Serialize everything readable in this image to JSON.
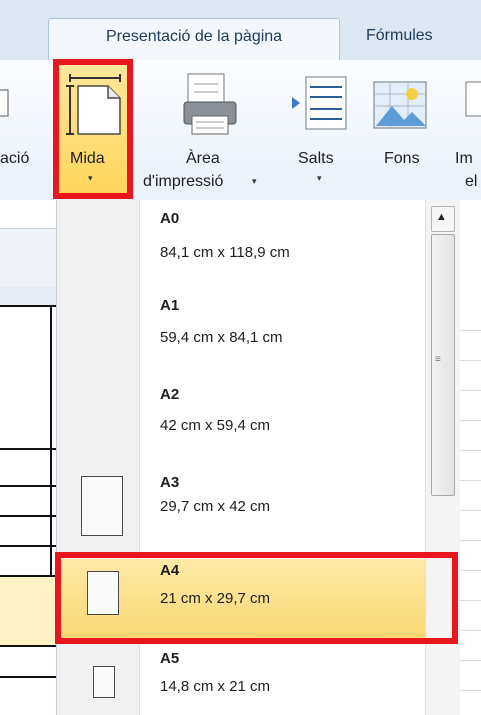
{
  "tabs": {
    "active": "Presentació de la pàgina",
    "other": "Fórmules"
  },
  "ribbon": {
    "prev_label": "ació",
    "mida_label": "Mida",
    "area_line1": "Àrea",
    "area_line2": "d'impressió",
    "salts_label": "Salts",
    "fons_label": "Fons",
    "imp_line1": "Im",
    "imp_line2": "el",
    "dropdown_glyph": "▾"
  },
  "dropdown": {
    "items": [
      {
        "name": "A0",
        "dim": "84,1 cm x 118,9 cm"
      },
      {
        "name": "A1",
        "dim": "59,4 cm x 84,1 cm"
      },
      {
        "name": "A2",
        "dim": "42 cm x 59,4 cm"
      },
      {
        "name": "A3",
        "dim": "29,7 cm x 42 cm"
      },
      {
        "name": "A4",
        "dim": "21 cm x 29,7 cm"
      },
      {
        "name": "A5",
        "dim": "14,8 cm x 21 cm"
      }
    ],
    "selected": "A4"
  },
  "scrollbar": {
    "up_glyph": "▲",
    "grip_glyph": "≡"
  },
  "colors": {
    "highlight": "#e8161e",
    "selected_fill": "#fbd874",
    "ribbon_hover": "#ffd65c"
  },
  "icons": [
    "page-size-icon",
    "print-area-icon",
    "breaks-icon",
    "background-icon"
  ]
}
